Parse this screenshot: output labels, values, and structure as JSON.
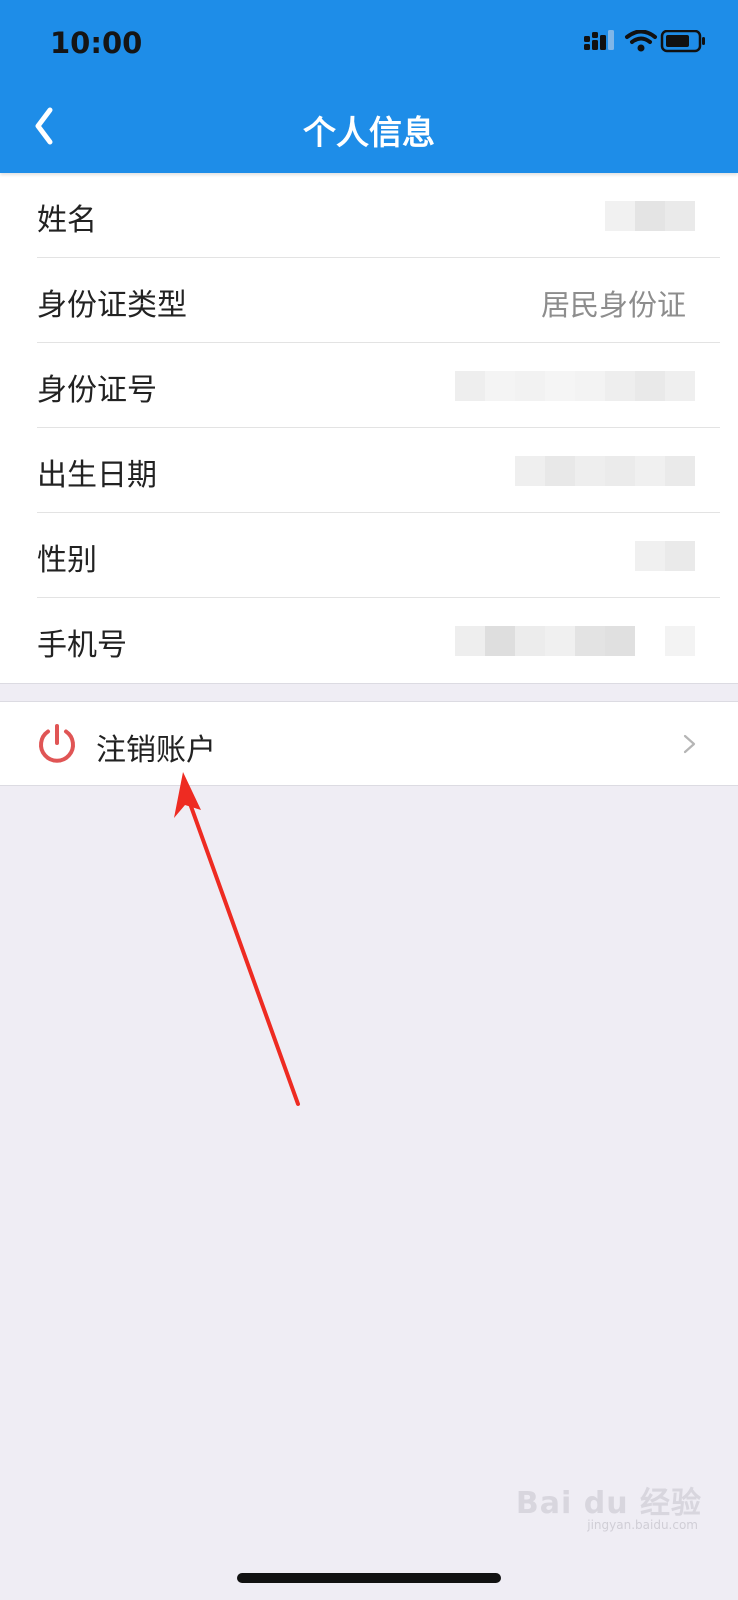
{
  "status_bar": {
    "time": "10:00",
    "icons": [
      "cellular-signal-icon",
      "wifi-icon",
      "battery-icon"
    ]
  },
  "nav": {
    "title": "个人信息",
    "back_icon": "chevron-left-icon"
  },
  "info_rows": [
    {
      "label": "姓名",
      "value": "",
      "redacted": true
    },
    {
      "label": "身份证类型",
      "value": "居民身份证",
      "redacted": false
    },
    {
      "label": "身份证号",
      "value": "",
      "redacted": true
    },
    {
      "label": "出生日期",
      "value": "",
      "redacted": true
    },
    {
      "label": "性别",
      "value": "",
      "redacted": true
    },
    {
      "label": "手机号",
      "value": "",
      "redacted": true
    }
  ],
  "account_action": {
    "label": "注销账户",
    "icon": "power-icon",
    "chevron": "chevron-right-icon"
  },
  "watermark": {
    "logo": "Bai du 经验",
    "url": "jingyan.baidu.com"
  },
  "colors": {
    "header": "#1e8de8",
    "background": "#efedf4",
    "power_icon": "#e05555",
    "annotation_arrow": "#ee2b22"
  }
}
